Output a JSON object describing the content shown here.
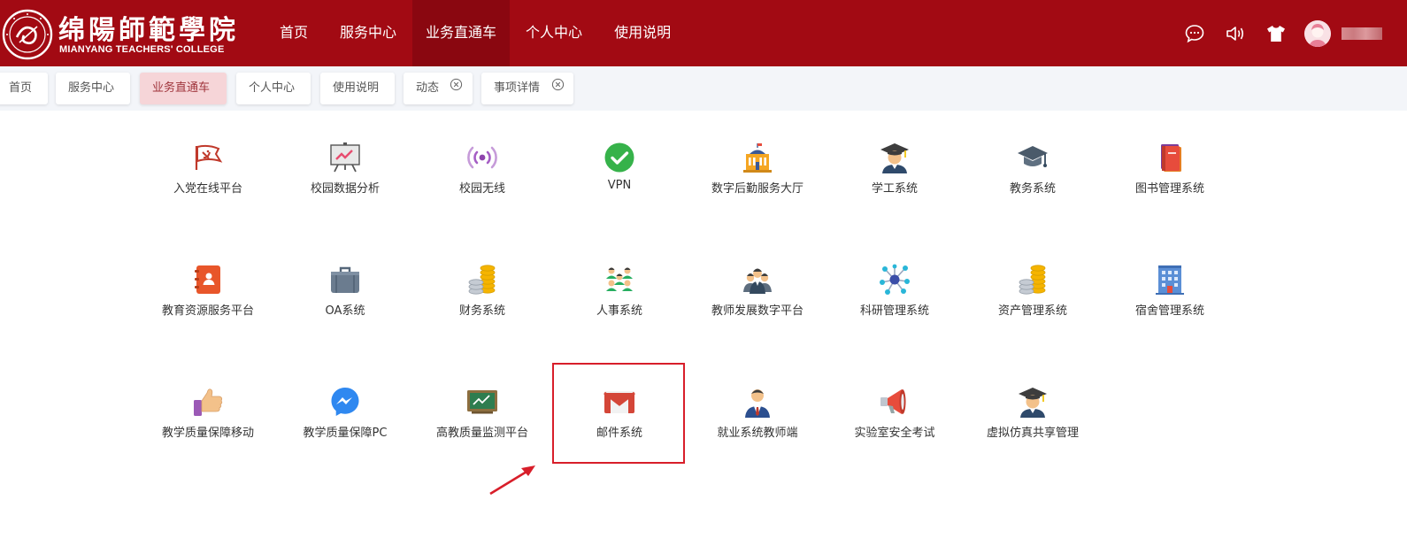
{
  "header": {
    "logo_cn": "绵陽師範學院",
    "logo_en": "MIANYANG TEACHERS' COLLEGE",
    "nav": [
      "首页",
      "服务中心",
      "业务直通车",
      "个人中心",
      "使用说明"
    ],
    "active_nav": "业务直通车",
    "icons": [
      "chat-icon",
      "volume-icon",
      "theme-shirt-icon",
      "avatar"
    ]
  },
  "tabs": [
    {
      "label": "首页"
    },
    {
      "label": "服务中心"
    },
    {
      "label": "业务直通车",
      "active": true
    },
    {
      "label": "个人中心"
    },
    {
      "label": "使用说明"
    },
    {
      "label": "动态",
      "closable": true
    },
    {
      "label": "事项详情",
      "closable": true
    }
  ],
  "apps": [
    {
      "label": "入党在线平台",
      "icon": "party-flag-icon"
    },
    {
      "label": "校园数据分析",
      "icon": "presentation-chart-icon"
    },
    {
      "label": "校园无线",
      "icon": "wireless-icon"
    },
    {
      "label": "VPN",
      "icon": "check-circle-icon"
    },
    {
      "label": "数字后勤服务大厅",
      "icon": "building-icon"
    },
    {
      "label": "学工系统",
      "icon": "graduate-icon"
    },
    {
      "label": "教务系统",
      "icon": "graduation-cap-icon"
    },
    {
      "label": "图书管理系统",
      "icon": "books-icon"
    },
    {
      "label": "教育资源服务平台",
      "icon": "contact-book-icon"
    },
    {
      "label": "OA系统",
      "icon": "briefcase-icon"
    },
    {
      "label": "财务系统",
      "icon": "coins-icon"
    },
    {
      "label": "人事系统",
      "icon": "people-group-icon"
    },
    {
      "label": "教师发展数字平台",
      "icon": "teachers-icon"
    },
    {
      "label": "科研管理系统",
      "icon": "molecule-icon"
    },
    {
      "label": "资产管理系统",
      "icon": "coins-stack-icon"
    },
    {
      "label": "宿舍管理系统",
      "icon": "dormitory-icon"
    },
    {
      "label": "教学质量保障移动",
      "icon": "thumbs-up-icon"
    },
    {
      "label": "教学质量保障PC",
      "icon": "messenger-icon"
    },
    {
      "label": "高教质量监测平台",
      "icon": "blackboard-icon"
    },
    {
      "label": "邮件系统",
      "icon": "gmail-icon",
      "highlighted": true
    },
    {
      "label": "就业系统教师端",
      "icon": "businessman-icon"
    },
    {
      "label": "实验室安全考试",
      "icon": "megaphone-icon"
    },
    {
      "label": "虚拟仿真共享管理",
      "icon": "scholar-icon"
    }
  ],
  "colors": {
    "brand_red": "#a20a13",
    "nav_active": "#8a0710",
    "tab_active_bg": "#f6d5d8",
    "highlight_border": "#d81e2a"
  }
}
